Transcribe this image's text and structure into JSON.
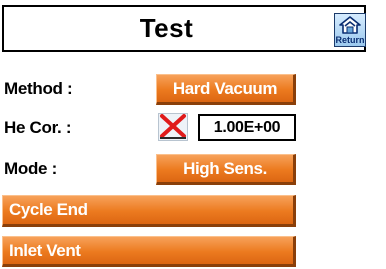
{
  "header": {
    "title": "Test",
    "return_label": "Return"
  },
  "method": {
    "label": "Method :",
    "value": "Hard Vacuum"
  },
  "he_cor": {
    "label": "He Cor. :",
    "value": "1.00E+00",
    "checkbox_icon": "red-x-icon",
    "enabled": false
  },
  "mode": {
    "label": "Mode :",
    "value": "High Sens."
  },
  "actions": {
    "cycle_end": "Cycle End",
    "inlet_vent": "Inlet Vent"
  },
  "colors": {
    "button": "#ec7a1f",
    "button_shadow": "#8a3f0a",
    "return_button": "#9cc9ee",
    "x_mark": "#e01b1b"
  }
}
